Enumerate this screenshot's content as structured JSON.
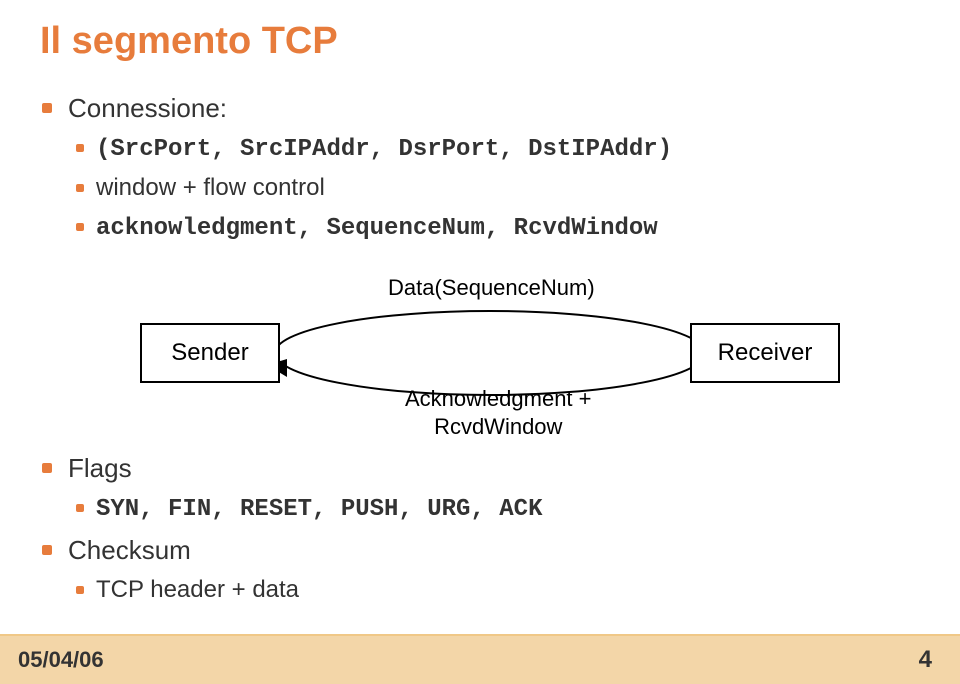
{
  "title": "Il segmento TCP",
  "top": {
    "connessione_label": "Connessione:",
    "tuple": "(SrcPort, SrcIPAddr, DsrPort, DstIPAddr)",
    "flow": "window + flow control",
    "ack_seq": "acknowledgment, SequenceNum, RcvdWindow"
  },
  "diagram": {
    "sender": "Sender",
    "receiver": "Receiver",
    "top_label": "Data(SequenceNum)",
    "bottom_label_1": "Acknowledgment +",
    "bottom_label_2": "RcvdWindow"
  },
  "bottom": {
    "flags_label": "Flags",
    "flags_values": "SYN, FIN, RESET, PUSH, URG, ACK",
    "checksum_label": "Checksum",
    "checksum_sub": "TCP header + data"
  },
  "footer": {
    "date": "05/04/06",
    "page": "4"
  }
}
